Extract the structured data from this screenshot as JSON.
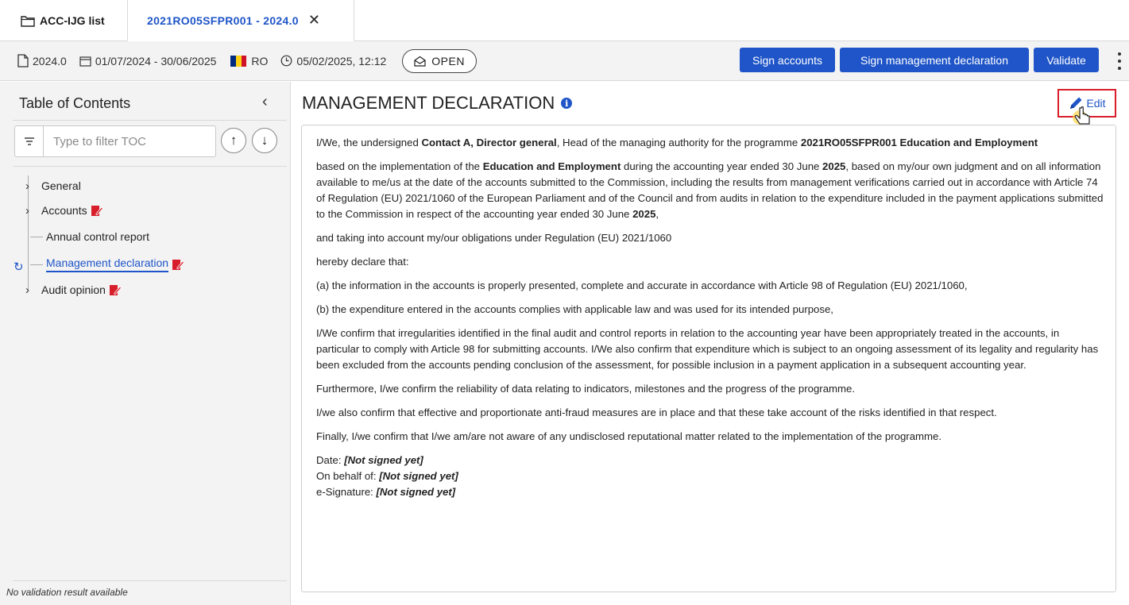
{
  "tabs": {
    "list_label": "ACC-IJG list",
    "active_label": "2021RO05SFPR001 - 2024.0",
    "close_glyph": "✕"
  },
  "toolbar": {
    "version": "2024.0",
    "period": "01/07/2024 - 30/06/2025",
    "country": "RO",
    "flag_colors": [
      "#002b7f",
      "#fcd116",
      "#ce1126"
    ],
    "timestamp": "05/02/2025, 12:12",
    "status": "OPEN",
    "buttons": {
      "sign_accounts": "Sign accounts",
      "sign_management": "Sign management declaration",
      "validate": "Validate"
    },
    "more_icon": "kebab-menu-icon"
  },
  "sidebar": {
    "title": "Table of Contents",
    "collapse_glyph": "‹",
    "filter_placeholder": "Type to filter TOC",
    "up_glyph": "↑",
    "down_glyph": "↓",
    "items": [
      {
        "label": "General",
        "expandable": true,
        "signed_icon": false
      },
      {
        "label": "Accounts",
        "expandable": true,
        "signed_icon": true
      },
      {
        "label": "Annual control report",
        "expandable": false,
        "signed_icon": false
      },
      {
        "label": "Management declaration",
        "expandable": false,
        "signed_icon": true,
        "active": true
      },
      {
        "label": "Audit opinion",
        "expandable": true,
        "signed_icon": true
      }
    ],
    "footer": "No validation result available"
  },
  "main": {
    "title": "MANAGEMENT DECLARATION",
    "info_glyph": "i",
    "edit_label": "Edit",
    "accent_color": "#1f55c8",
    "highlight_color": "#d81e2a",
    "paragraphs": {
      "p1_a": "I/We, the undersigned ",
      "p1_b": "Contact A, Director general",
      "p1_c": ", Head of the managing authority for the programme ",
      "p1_d": "2021RO05SFPR001 Education and Employment",
      "p2_a": "based on the implementation of the ",
      "p2_b": "Education and Employment",
      "p2_c": " during the accounting year ended 30 June ",
      "p2_d": "2025",
      "p2_e": ", based on my/our own judgment and on all information available to me/us at the date of the accounts submitted to the Commission, including the results from management verifications carried out in accordance with Article 74 of Regulation (EU) 2021/1060 of the European Parliament and of the Council and from audits in relation to the expenditure included in the payment applications submitted to the Commission in respect of the accounting year ended 30 June ",
      "p2_f": "2025",
      "p2_g": ",",
      "p3": "and taking into account my/our obligations under Regulation (EU) 2021/1060",
      "p4": "hereby declare that:",
      "p5": "(a) the information in the accounts is properly presented, complete and accurate in accordance with Article 98 of Regulation (EU) 2021/1060,",
      "p6": "(b) the expenditure entered in the accounts complies with applicable law and was used for its intended purpose,",
      "p7": "I/We confirm that irregularities identified in the final audit and control reports in relation to the accounting year have been appropriately treated in the accounts, in particular to comply with Article 98 for submitting accounts. I/We also confirm that expenditure which is subject to an ongoing assessment of its legality and regularity has been excluded from the accounts pending conclusion of the assessment, for possible inclusion in a payment application in a subsequent accounting year.",
      "p8": "Furthermore, I/we confirm the reliability of data relating to indicators, milestones and the progress of the programme.",
      "p9": "I/we also confirm that effective and proportionate anti-fraud measures are in place and that these take account of the risks identified in that respect.",
      "p10": "Finally, I/we confirm that I/we am/are not aware of any undisclosed reputational matter related to the implementation of the programme."
    },
    "signature": {
      "date_label": "Date: ",
      "date_value": "[Not signed yet]",
      "behalf_label": "On behalf of: ",
      "behalf_value": "[Not signed yet]",
      "esig_label": "e-Signature: ",
      "esig_value": "[Not signed yet]"
    }
  }
}
